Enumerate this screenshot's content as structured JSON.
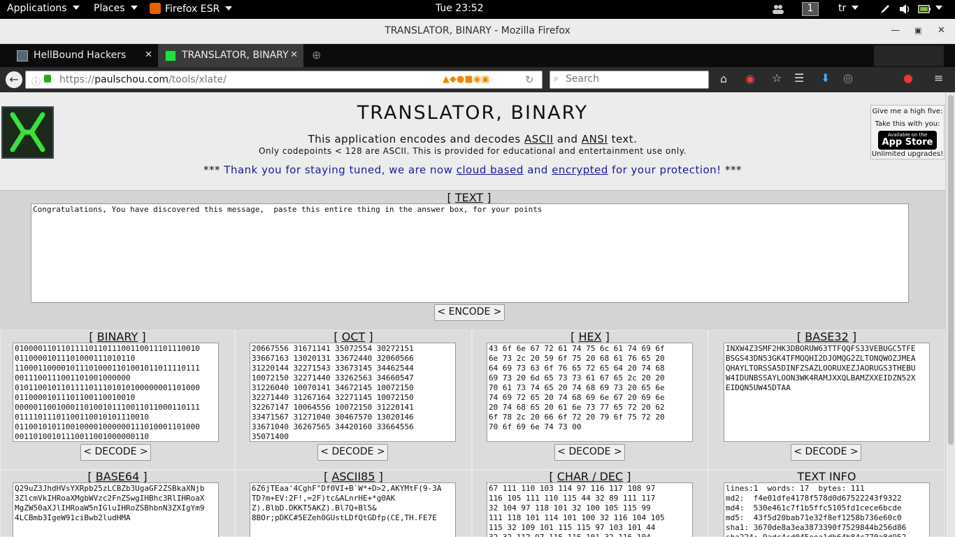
{
  "topbar": {
    "applications": "Applications",
    "places": "Places",
    "firefox": "Firefox ESR",
    "clock": "Tue 23:52",
    "workspace": "1",
    "lang": "tr"
  },
  "window": {
    "title": "TRANSLATOR, BINARY - Mozilla Firefox"
  },
  "tabs": [
    {
      "label": "HellBound Hackers"
    },
    {
      "label": "TRANSLATOR, BINARY"
    }
  ],
  "nav": {
    "url_scheme": "https://",
    "url_domain": "paulschou.com",
    "url_path": "/tools/xlate/",
    "search_placeholder": "Search"
  },
  "page": {
    "title": "TRANSLATOR, BINARY",
    "subtitle_pre": "This application encodes and decodes ",
    "subtitle_ascii": "ASCII",
    "subtitle_and": " and ",
    "subtitle_ansi": "ANSI",
    "subtitle_post": " text.",
    "note": "Only codepoints < 128 are ASCII. This is provided for educational and entertainment use only.",
    "banner_stars_left": "*** ",
    "banner_text1": "Thank you for staying tuned, we are now ",
    "banner_link1": "cloud based",
    "banner_and": " and ",
    "banner_link2": "encrypted",
    "banner_text2": " for your protection!",
    "banner_stars_right": " ***",
    "hifive_title": "Give me a high five:",
    "hifive_take": "Take this with you:",
    "appstore_small": "Available on the",
    "appstore_big": "App Store",
    "hifive_upgrades": "Unlimited upgrades!"
  },
  "text_section": {
    "heading": "TEXT",
    "value": "Congratulations, You have discovered this message,  paste this entire thing in the answer box, for your points",
    "encode_button": "< ENCODE >"
  },
  "panels": [
    {
      "heading": "BINARY",
      "decode": "< DECODE >",
      "value": "0100001101101111011011100110011101110010\n01100001011101000111010110\n1100011000010111010001101001011011110111\n0011100111001101001000000\n0101100101101111011101010100000001101000\n01100001011101100110010010\n0000011001000110100101110011011000110111\n01111011101100110010101110010\n0110010101100100001000000111010001101000\n00110100101110011001000000110"
    },
    {
      "heading": "OCT",
      "decode": "< DECODE >",
      "value": "20667556 31671141 35072554 30272151\n33667163 13020131 33672440 32060566\n31220144 32271543 33673145 34462544\n10072150 32271440 33262563 34660547\n31226040 10070141 34672145 10072150\n32271440 31267164 32271145 10072150\n32267147 10064556 10072150 31220141\n33471567 31271040 30467570 13020146\n33671040 36267565 34420160 33664556\n35071400"
    },
    {
      "heading": "HEX",
      "decode": "< DECODE >",
      "value": "43 6f 6e 67 72 61 74 75 6c 61 74 69 6f\n6e 73 2c 20 59 6f 75 20 68 61 76 65 20\n64 69 73 63 6f 76 65 72 65 64 20 74 68\n69 73 20 6d 65 73 73 61 67 65 2c 20 20\n70 61 73 74 65 20 74 68 69 73 20 65 6e\n74 69 72 65 20 74 68 69 6e 67 20 69 6e\n20 74 68 65 20 61 6e 73 77 65 72 20 62\n6f 78 2c 20 66 6f 72 20 79 6f 75 72 20\n70 6f 69 6e 74 73 00"
    },
    {
      "heading": "BASE32",
      "decode": "< DECODE >",
      "value": "INXW4Z3SMF2HK3DBORUW63TTFQQFS33VEBUGC5TFE\nBSGS43DN53GK4TFMQQHI2DJOMQG2ZLTONQWOZJMEA\nQHAYLTORSSA5DINFZSAZLOORUXEZJAORUGS3THEBU\nW4IDUNBSSAYLOON3WK4RAMJXXQLBAMZXXEIDZN52X\nEIDQN5UW45DTAA"
    },
    {
      "heading": "BASE64",
      "value": "Q29uZ3JhdHVsYXRpb25zLCBZb3UgaGF2ZSBkaXNjb\n3ZlcmVkIHRoaXMgbWVzc2FnZSwgIHBhc3RlIHRoaX\nMgZW50aXJlIHRoaW5nIGluIHRoZSBhbnN3ZXIgYm9\n4LCBmb3IgeW91ciBwb2ludHMA"
    },
    {
      "heading": "ASCII85",
      "value": "6Z6jTEaa'4CghF\"Df0VI+B`W*+D>2,AKYMtF(9-3A\nTD?m+EV:2F!,=2F)tc&ALnrHE+*g0AK\nZ).BlbD.DKKT5AKZ).Bl7Q+Bl5&\n8BOr;pDKC#5EZeh0GUstLDfQtGDfp(CE,TH.FE7E"
    },
    {
      "heading": "CHAR / DEC",
      "value": "67 111 110 103 114 97 116 117 108 97\n116 105 111 110 115 44 32 89 111 117\n32 104 97 118 101 32 100 105 115 99\n111 118 101 114 101 100 32 116 104 105\n115 32 109 101 115 115 97 103 101 44\n32 32 112 97 115 116 101 32 116 104"
    },
    {
      "heading": "TEXT INFO",
      "value": "lines:1  words: 17  bytes: 111\nmd2:  f4e01dfe4178f578d0d67522243f9322\nmd4:  530e461c7f1b5ffc5105fd1cece6bcde\nmd5:  43f5d20bab71e32f8ef1258b736e60c0\nsha1: 3670de8a3ea3873390f7529844b256d86\nsha224: 9adc4cd045eea1db64b84c770a8d952"
    }
  ],
  "colors": {
    "banner_blue": "#1a1aa0",
    "topbar_bg": "#000000",
    "tabbar_bg": "#0c0c0c",
    "active_tab": "#3b3b3b"
  }
}
